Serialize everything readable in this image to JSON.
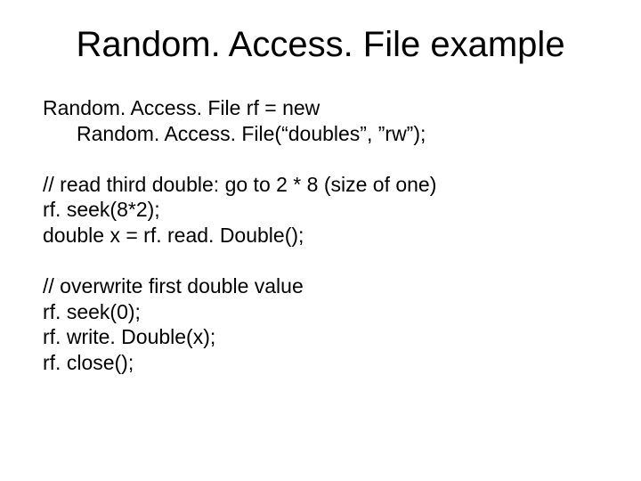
{
  "slide": {
    "title": "Random. Access. File example",
    "para1": {
      "l1": "Random. Access. File rf = new",
      "l2": "Random. Access. File(“doubles”, ”rw”);"
    },
    "para2": {
      "l1": "// read third double: go to 2 * 8 (size of one)",
      "l2": "rf. seek(8*2);",
      "l3": "double x = rf. read. Double();"
    },
    "para3": {
      "l1": "// overwrite first double value",
      "l2": "rf. seek(0);",
      "l3": "rf. write. Double(x);",
      "l4": "rf. close();"
    }
  }
}
